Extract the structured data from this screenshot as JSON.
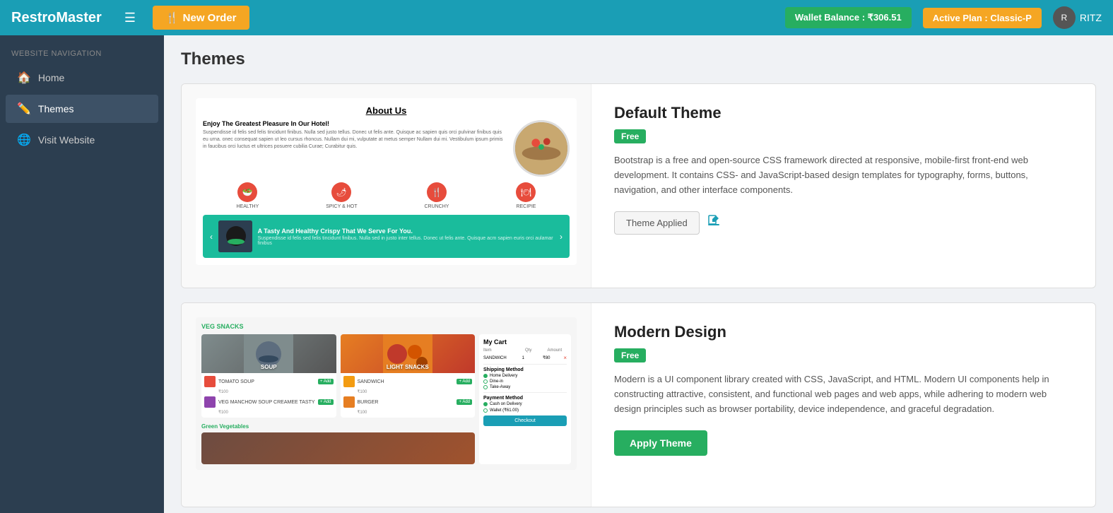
{
  "topNav": {
    "brand": "RestroMaster",
    "hamburger_label": "☰",
    "new_order_icon": "🍴",
    "new_order_label": "New Order",
    "wallet_label": "Wallet Balance : ₹306.51",
    "plan_label": "Active Plan : Classic-P",
    "user_name": "RITZ"
  },
  "sidebar": {
    "section_label": "WEBSITE NAVIGATION",
    "items": [
      {
        "id": "home",
        "icon": "🏠",
        "label": "Home"
      },
      {
        "id": "themes",
        "icon": "✏️",
        "label": "Themes"
      },
      {
        "id": "visit-website",
        "icon": "🌐",
        "label": "Visit Website"
      }
    ]
  },
  "mainContent": {
    "page_title": "Themes",
    "themes": [
      {
        "id": "default",
        "name": "Default Theme",
        "badge": "Free",
        "description": "Bootstrap is a free and open-source CSS framework directed at responsive, mobile-first front-end web development. It contains CSS- and JavaScript-based design templates for typography, forms, buttons, navigation, and other interface components.",
        "action_label": "Theme Applied",
        "edit_icon": "✏️"
      },
      {
        "id": "modern",
        "name": "Modern Design",
        "badge": "Free",
        "description": "Modern is a UI component library created with CSS, JavaScript, and HTML. Modern UI components help in constructing attractive, consistent, and functional web pages and web apps, while adhering to modern web design principles such as browser portability, device independence, and graceful degradation.",
        "action_label": "Apply Theme"
      }
    ]
  },
  "preview1": {
    "about_title": "About Us",
    "about_heading": "Enjoy The Greatest Pleasure In Our Hotel!",
    "about_para": "Suspendisse id felis sed felis tincidunt finibus. Nulla sed justo tellus. Donec ut felis ante. Quisque ac sapien quis orci pulvinar finibus quis eu urna. onec consequat sapien ut leo cursus rhoncus. Nullam dui mi, vulputate at metus semper Nullam dui mi. Vestibulum ipsum primis in faucibus orci luctus et ultrices posuere cubilia Curae; Curabitur quis.",
    "icons": [
      {
        "label": "HEALTHY",
        "emoji": "🥗"
      },
      {
        "label": "SPICY & HOT",
        "emoji": "🌶"
      },
      {
        "label": "CRUNCHY",
        "emoji": "🍴"
      },
      {
        "label": "RECIPIE",
        "emoji": "🍽"
      }
    ],
    "banner_title": "A Tasty And Healthy Crispy That We Serve For You.",
    "banner_sub": "Suspendisse id felis sed felis tincidunt finibus. Nulla sed in justo inter tellus. Donec ut felis ante. Quisque acm sapien euris orci aulamar finibus"
  },
  "preview2": {
    "category": "VEG SNACKS",
    "food_sections": [
      {
        "label": "SOUP",
        "type": "soup"
      },
      {
        "label": "LIGHT SNACKS",
        "type": "snacks"
      }
    ],
    "items_left": [
      {
        "name": "TOMATO SOUP",
        "price": "₹100"
      },
      {
        "name": "VEG MANCHOW SOUP CREAMEE TASTY",
        "price": "₹100"
      }
    ],
    "items_right": [
      {
        "name": "SANDWICH",
        "price": "₹100"
      },
      {
        "name": "BURGER",
        "price": "₹100"
      }
    ],
    "cart_title": "My Cart",
    "cart_headers": [
      "Item",
      "Qty",
      "Amount"
    ],
    "cart_items": [
      {
        "name": "SANDWICH",
        "qty": "1",
        "price": "₹80"
      }
    ],
    "shipping_label": "Shipping Method",
    "shipping_options": [
      "Home Delivery",
      "Dine-in",
      "Take-Away"
    ],
    "payment_label": "Payment Method",
    "payment_options": [
      "Cash on Delivery",
      "Wallet (₹61.00)"
    ],
    "checkout_label": "Checkout",
    "green_label": "Green Vegetables"
  }
}
